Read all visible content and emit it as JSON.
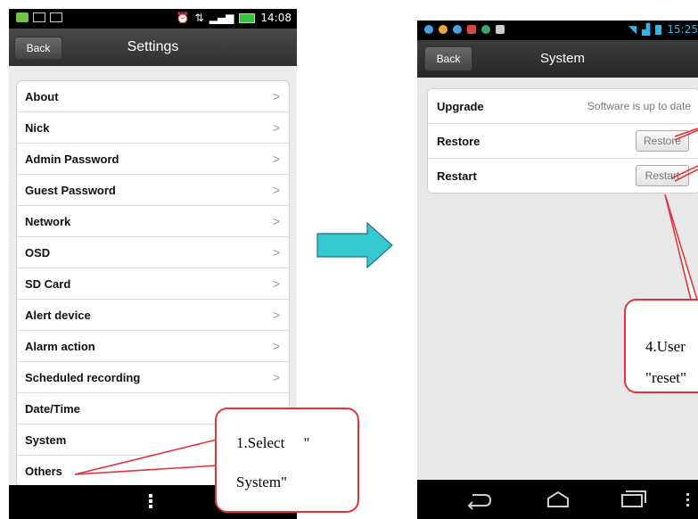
{
  "left_phone": {
    "status": {
      "time": "14:08"
    },
    "header": {
      "back_label": "Back",
      "title": "Settings"
    },
    "items": [
      {
        "label": "About",
        "chevron": ">"
      },
      {
        "label": "Nick",
        "chevron": ">"
      },
      {
        "label": "Admin Password",
        "chevron": ">"
      },
      {
        "label": "Guest Password",
        "chevron": ">"
      },
      {
        "label": "Network",
        "chevron": ">"
      },
      {
        "label": "OSD",
        "chevron": ">"
      },
      {
        "label": "SD Card",
        "chevron": ">"
      },
      {
        "label": "Alert device",
        "chevron": ">"
      },
      {
        "label": "Alarm action",
        "chevron": ">"
      },
      {
        "label": "Scheduled recording",
        "chevron": ">"
      },
      {
        "label": "Date/Time",
        "chevron": ""
      },
      {
        "label": "System",
        "chevron": ""
      },
      {
        "label": "Others",
        "chevron": ""
      }
    ]
  },
  "right_phone": {
    "status": {
      "time": "15:25"
    },
    "header": {
      "back_label": "Back",
      "title": "System"
    },
    "rows": {
      "upgrade": {
        "label": "Upgrade",
        "value": "Software is up to date"
      },
      "restore": {
        "label": "Restore",
        "button": "Restore"
      },
      "restart": {
        "label": "Restart",
        "button": "Restart"
      }
    }
  },
  "annotations": {
    "callout1": {
      "line1": "1.Select     \"",
      "line2": "System\""
    },
    "callout4": {
      "line1": "4.User",
      "line2": "\"reset\""
    }
  },
  "colors": {
    "arrow_fill": "#33c9cf",
    "callout_border": "#e2343a"
  }
}
